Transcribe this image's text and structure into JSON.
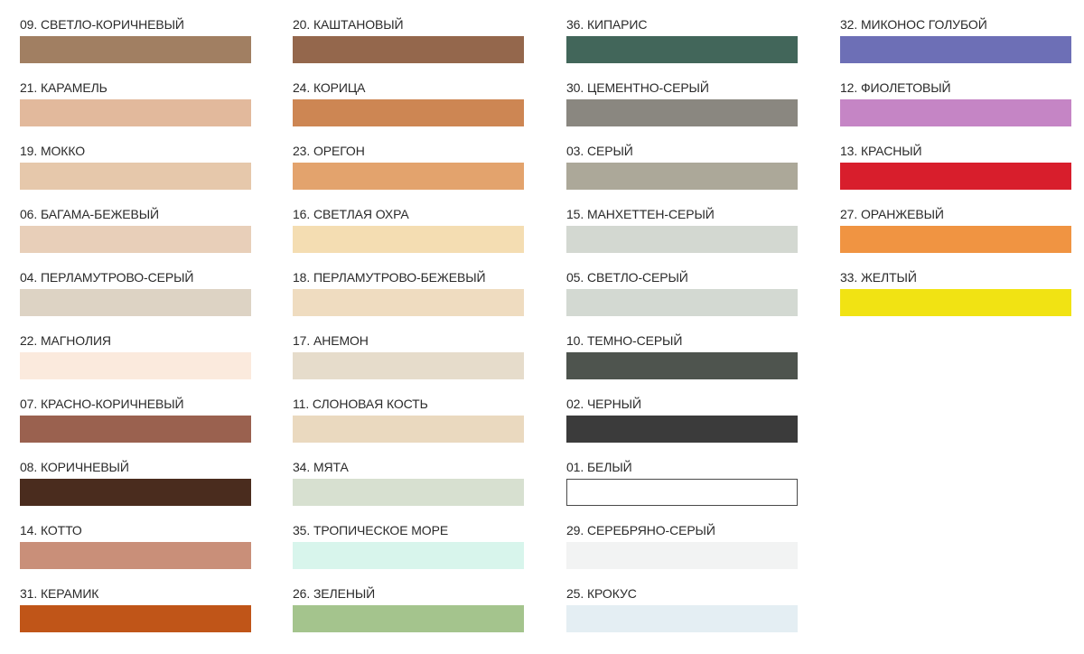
{
  "columns": [
    [
      {
        "label": "09. СВЕТЛО-КОРИЧНЕВЫЙ",
        "color": "#a17f62"
      },
      {
        "label": "21. КАРАМЕЛЬ",
        "color": "#e2b99c"
      },
      {
        "label": "19. МОККО",
        "color": "#e6c8ab"
      },
      {
        "label": "06. БАГАМА-БЕЖЕВЫЙ",
        "color": "#e8cfb9"
      },
      {
        "label": "04. ПЕРЛАМУТРОВО-СЕРЫЙ",
        "color": "#ddd3c4"
      },
      {
        "label": "22. МАГНОЛИЯ",
        "color": "#fbeadd"
      },
      {
        "label": "07. КРАСНО-КОРИЧНЕВЫЙ",
        "color": "#9a614f"
      },
      {
        "label": "08. КОРИЧНЕВЫЙ",
        "color": "#4a2c1e"
      },
      {
        "label": "14. КОТТО",
        "color": "#c98f79"
      },
      {
        "label": "31. КЕРАМИК",
        "color": "#c05518"
      }
    ],
    [
      {
        "label": "20. КАШТАНОВЫЙ",
        "color": "#94674c"
      },
      {
        "label": "24. КОРИЦА",
        "color": "#cd8653"
      },
      {
        "label": "23. ОРЕГОН",
        "color": "#e3a36d"
      },
      {
        "label": "16. СВЕТЛАЯ ОХРА",
        "color": "#f4ddb2"
      },
      {
        "label": "18. ПЕРЛАМУТРОВО-БЕЖЕВЫЙ",
        "color": "#efdcc0"
      },
      {
        "label": "17. АНЕМОН",
        "color": "#e6dccb"
      },
      {
        "label": "11. СЛОНОВАЯ КОСТЬ",
        "color": "#ead9bf"
      },
      {
        "label": "34. МЯТА",
        "color": "#d7e0d0"
      },
      {
        "label": "35. ТРОПИЧЕСКОЕ МОРЕ",
        "color": "#d8f5ec"
      },
      {
        "label": "26. ЗЕЛЕНЫЙ",
        "color": "#a4c48d"
      }
    ],
    [
      {
        "label": "36. КИПАРИС",
        "color": "#42665a"
      },
      {
        "label": "30. ЦЕМЕНТНО-СЕРЫЙ",
        "color": "#8a8780"
      },
      {
        "label": "03. СЕРЫЙ",
        "color": "#aca899"
      },
      {
        "label": "15. МАНХЕТТЕН-СЕРЫЙ",
        "color": "#d3d8d1"
      },
      {
        "label": "05. СВЕТЛО-СЕРЫЙ",
        "color": "#d3d9d2"
      },
      {
        "label": "10. ТЕМНО-СЕРЫЙ",
        "color": "#4e544e"
      },
      {
        "label": "02. ЧЕРНЫЙ",
        "color": "#3b3b3b"
      },
      {
        "label": "01. БЕЛЫЙ",
        "color": "#ffffff",
        "outlined": true
      },
      {
        "label": "29. СЕРЕБРЯНО-СЕРЫЙ",
        "color": "#f2f3f3"
      },
      {
        "label": "25. КРОКУС",
        "color": "#e4eef3"
      }
    ],
    [
      {
        "label": "32. МИКОНОС ГОЛУБОЙ",
        "color": "#6d6fb6"
      },
      {
        "label": "12. ФИОЛЕТОВЫЙ",
        "color": "#c585c5"
      },
      {
        "label": "13. КРАСНЫЙ",
        "color": "#d81e2c"
      },
      {
        "label": "27. ОРАНЖЕВЫЙ",
        "color": "#f09442"
      },
      {
        "label": "33. ЖЕЛТЫЙ",
        "color": "#f1e313"
      }
    ]
  ]
}
